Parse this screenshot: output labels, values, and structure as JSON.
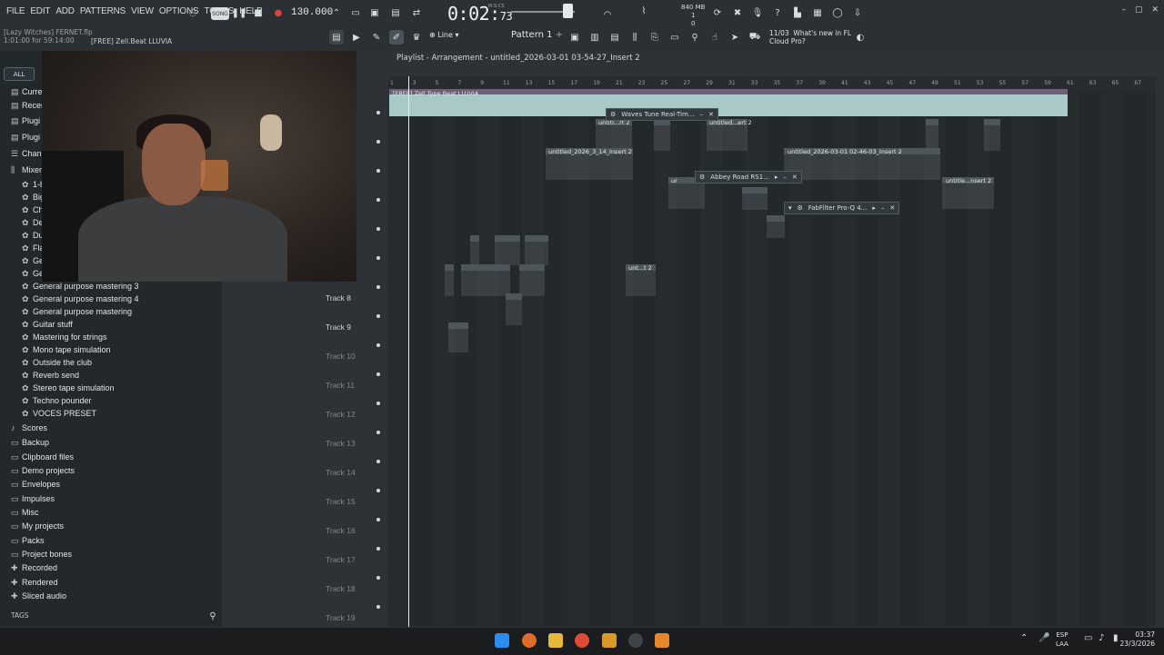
{
  "menu": [
    "FILE",
    "EDIT",
    "ADD",
    "PATTERNS",
    "VIEW",
    "OPTIONS",
    "TOOLS",
    "HELP"
  ],
  "hint": {
    "project": "[Lazy Witches] FERNET.flp",
    "time": "1:01:00 for 59:14:00",
    "clip": "[FREE] Zell.Beat  LLUVIA"
  },
  "transport": {
    "song_label": "SONG",
    "tempo": "130.000",
    "time_main": "0:02",
    "time_small": "73",
    "mcs": "M:S:CS"
  },
  "memory": {
    "value": "840 MB",
    "cpu": "1",
    "line3": "0"
  },
  "news": {
    "date": "11/03",
    "line1": "What's new in FL",
    "line2": "Cloud Pro?"
  },
  "toolbar": {
    "snap": "Line",
    "pattern": "Pattern 1"
  },
  "playlist": {
    "title": "Playlist - Arrangement - untitled_2026-03-01 03-54-27_Insert 2"
  },
  "ruler": [
    "1",
    "3",
    "5",
    "7",
    "9",
    "11",
    "13",
    "15",
    "17",
    "19",
    "21",
    "23",
    "25",
    "27",
    "29",
    "31",
    "33",
    "35",
    "37",
    "39",
    "41",
    "43",
    "45",
    "47",
    "49",
    "51",
    "53",
    "55",
    "57",
    "59",
    "61",
    "63",
    "65",
    "67"
  ],
  "browser": {
    "all_label": "ALL",
    "top_items": [
      {
        "icon": "folder-icon",
        "label": "Curre"
      },
      {
        "icon": "folder-icon",
        "label": "Recen"
      },
      {
        "icon": "plug-icon",
        "label": "Plugi"
      },
      {
        "icon": "plug-icon",
        "label": "Plugi"
      },
      {
        "icon": "channel-icon",
        "label": "Chann"
      },
      {
        "icon": "mixer-icon",
        "label": "Mixer"
      }
    ],
    "mixer_items": [
      "1-b",
      "Big",
      "Cho",
      "Def",
      "Dua",
      "Flar",
      "Ger",
      "Ger",
      "General purpose mastering 3",
      "General purpose mastering 4",
      "General purpose mastering",
      "Guitar stuff",
      "Mastering for strings",
      "Mono tape simulation",
      "Outside the club",
      "Reverb send",
      "Stereo tape simulation",
      "Techno pounder",
      "VOCES PRESET"
    ],
    "folders": [
      {
        "icon": "note-icon",
        "label": "Scores"
      },
      {
        "icon": "folder-icon",
        "label": "Backup"
      },
      {
        "icon": "folder-icon",
        "label": "Clipboard files"
      },
      {
        "icon": "folder-icon",
        "label": "Demo projects"
      },
      {
        "icon": "folder-icon",
        "label": "Envelopes"
      },
      {
        "icon": "folder-icon",
        "label": "Impulses"
      },
      {
        "icon": "folder-icon",
        "label": "Misc"
      },
      {
        "icon": "folder-icon",
        "label": "My projects"
      },
      {
        "icon": "folder-icon",
        "label": "Packs"
      },
      {
        "icon": "folder-icon",
        "label": "Project bones"
      },
      {
        "icon": "plus-icon",
        "label": "Recorded"
      },
      {
        "icon": "plus-icon",
        "label": "Rendered"
      },
      {
        "icon": "plus-icon",
        "label": "Sliced audio"
      }
    ],
    "tags_label": "TAGS"
  },
  "tracks": [
    "Track 8",
    "Track 9",
    "Track 10",
    "Track 11",
    "Track 12",
    "Track 13",
    "Track 14",
    "Track 15",
    "Track 16",
    "Track 17",
    "Track 18",
    "Track 19"
  ],
  "clips": {
    "top": "[FREE] Zell Type Beat  LLUVIA",
    "c1": "untitl...rt 2",
    "c2": "untitled...ert 2",
    "c3": "untitled_2026_3_14_Insert 2",
    "c4": "untitled_2026-03-01 02-46-03_Insert 2",
    "c5": "untitle...nsert 2",
    "c6": "unt...t 2",
    "c7": "unt...rt 2",
    "c8": "ur"
  },
  "plugins": {
    "p1": "Waves Tune Real-Tim...",
    "p2": "Abbey Road RS1...",
    "p3": "FabFilter Pro-Q 4..."
  },
  "taskbar": {
    "lang1": "ESP",
    "lang2": "LAA",
    "time": "03:37",
    "date": "23/3/2026"
  }
}
